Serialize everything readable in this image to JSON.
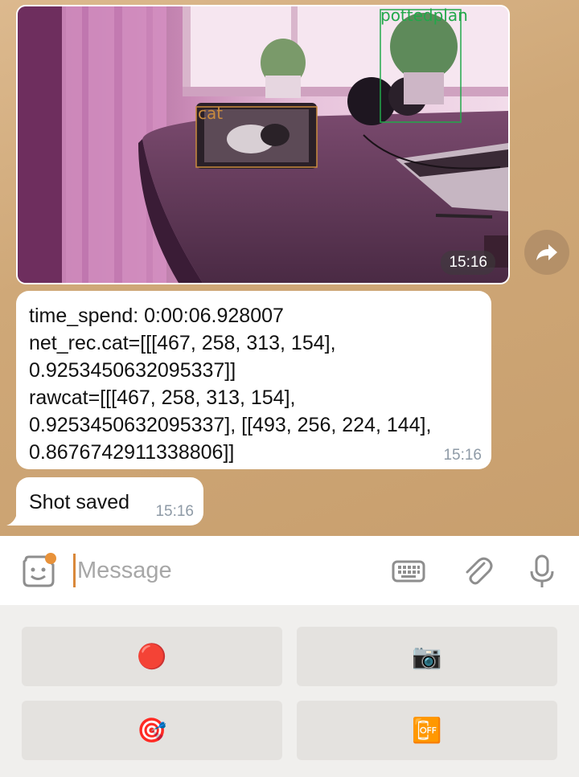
{
  "messages": {
    "photo": {
      "time": "15:16",
      "detections": [
        {
          "label": "pottedplan",
          "color": "#22a84a"
        },
        {
          "label": "cat",
          "color": "#c98a3e"
        }
      ]
    },
    "info": {
      "lines": [
        "time_spend: 0:00:06.928007",
        "net_rec.cat=[[[467, 258, 313, 154],",
        "0.9253450632095337]]",
        "rawcat=[[[467, 258, 313, 154],",
        "0.9253450632095337], [[493, 256, 224, 144],",
        "0.8676742911338806]]"
      ],
      "time": "15:16"
    },
    "saved": {
      "text": "Shot saved",
      "time": "15:16"
    }
  },
  "input": {
    "placeholder": "Message"
  },
  "icons": {
    "emoji": "sticker-emoji-icon",
    "keyboard": "keyboard-icon",
    "attach": "paperclip-icon",
    "mic": "microphone-icon",
    "share": "share-arrow-icon"
  },
  "keyboard_buttons": [
    {
      "emoji": "🔴",
      "icon": "red-circle-icon"
    },
    {
      "emoji": "📷",
      "icon": "camera-icon"
    },
    {
      "emoji": "🎯",
      "icon": "target-icon"
    },
    {
      "emoji": "📴",
      "icon": "off-icon"
    }
  ],
  "colors": {
    "accent": "#e8923a",
    "chat_bg": "#cfa878",
    "time_gray": "#8e9aa6"
  }
}
